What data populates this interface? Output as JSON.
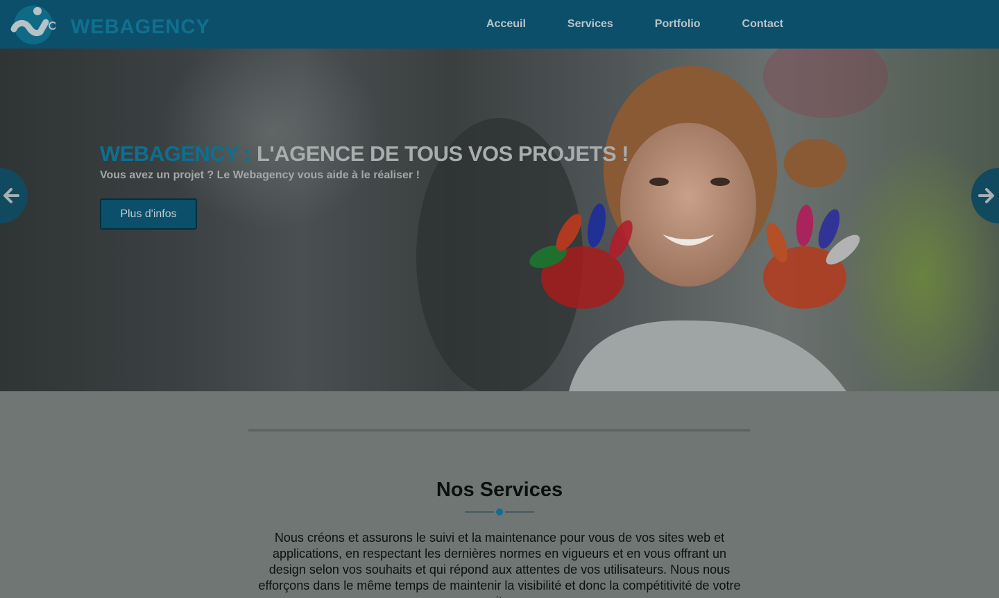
{
  "header": {
    "logo_text": "WEBAGENCY",
    "nav": [
      "Acceuil",
      "Services",
      "Portfolio",
      "Contact"
    ]
  },
  "hero": {
    "title_brand": "WEBAGENCY :",
    "title_rest": " L'AGENCE DE TOUS VOS PROJETS !",
    "subtitle": "Vous avez un projet ? Le Webagency vous aide à le réaliser !",
    "button_label": "Plus d'infos",
    "prev_icon": "arrow-left-icon",
    "next_icon": "arrow-right-icon"
  },
  "services": {
    "title": "Nos Services",
    "text": "Nous créons et assurons le suivi et la maintenance pour vous de vos sites web et applications, en respectant les dernières normes en vigueurs et en vous offrant un design selon vos souhaits et qui répond aux attentes de vos utilisateurs. Nous nous efforçons dans le même temps de maintenir la visibilité et donc la compétitivité de votre site"
  },
  "colors": {
    "header_bg": "#0c4f6b",
    "accent": "#0e6f90",
    "overlay_bg": "#6f7674"
  }
}
